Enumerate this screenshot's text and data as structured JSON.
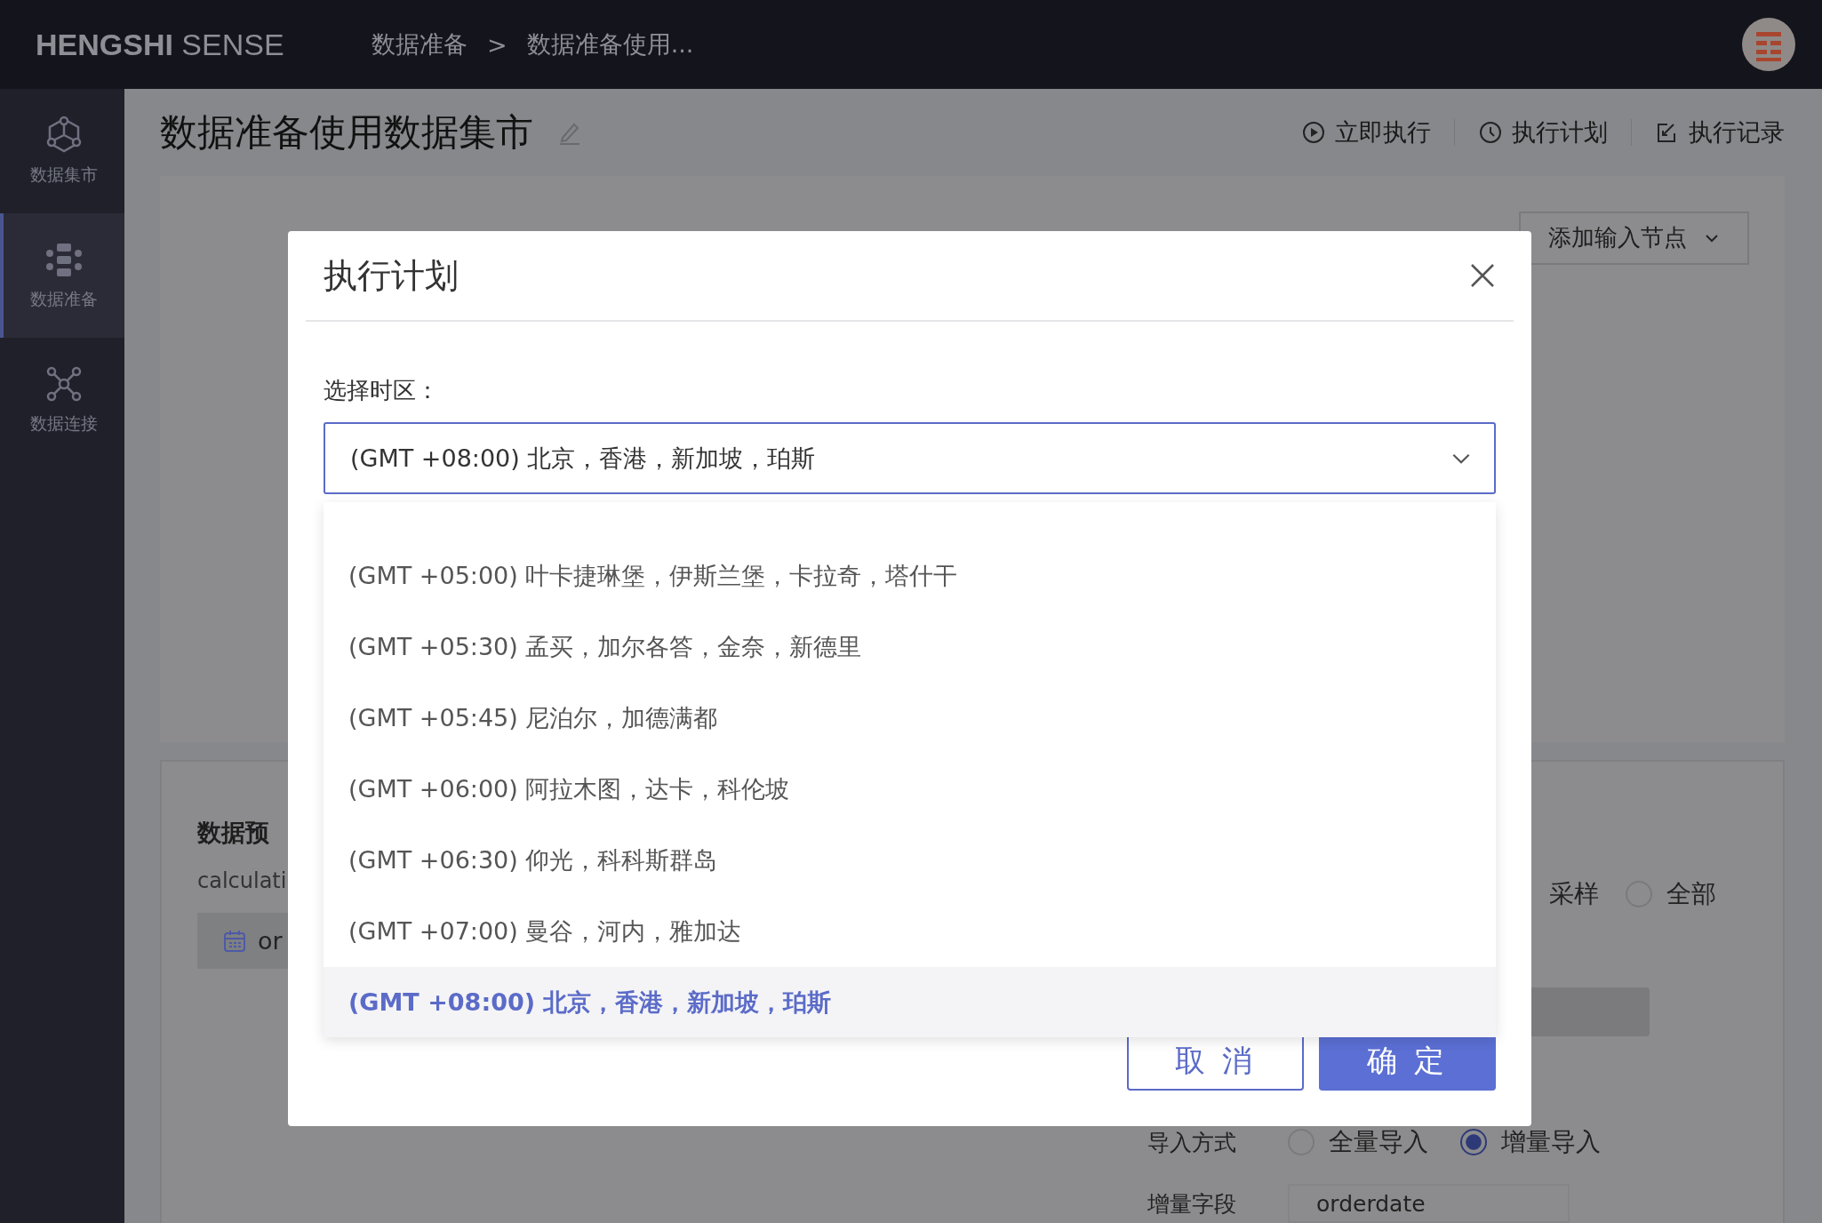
{
  "app": {
    "logo_bold": "HENGSHI",
    "logo_light": "SENSE"
  },
  "breadcrumb": {
    "items": [
      "数据准备",
      "数据准备使用..."
    ],
    "separator": ">"
  },
  "sidebar": {
    "items": [
      {
        "label": "数据集市",
        "kind": "mart",
        "selected": false
      },
      {
        "label": "数据准备",
        "kind": "prep",
        "selected": true
      },
      {
        "label": "数据连接",
        "kind": "connect",
        "selected": false
      }
    ]
  },
  "page": {
    "title": "数据准备使用数据集市",
    "actions": [
      {
        "label": "立即执行",
        "kind": "run"
      },
      {
        "label": "执行计划",
        "kind": "schedule"
      },
      {
        "label": "执行记录",
        "kind": "log"
      }
    ]
  },
  "canvas": {
    "add_node_button": "添加输入节点"
  },
  "preview": {
    "title": "数据预",
    "subtitle": "calculati",
    "chip": "or"
  },
  "sampling": {
    "partial_label": "采样",
    "options": [
      {
        "label": "全部",
        "selected": false
      }
    ]
  },
  "import": {
    "label": "导入方式",
    "options": [
      {
        "label": "全量导入",
        "selected": false
      },
      {
        "label": "增量导入",
        "selected": true
      }
    ]
  },
  "increment": {
    "label": "增量字段",
    "value": "orderdate"
  },
  "dialog": {
    "title": "执行计划",
    "timezone_label": "选择时区：",
    "timezone_value": "(GMT +08:00) 北京，香港，新加坡，珀斯",
    "options": [
      {
        "label": "(GMT +05:00) 叶卡捷琳堡，伊斯兰堡，卡拉奇，塔什干",
        "selected": false
      },
      {
        "label": "(GMT +05:30) 孟买，加尔各答，金奈，新德里",
        "selected": false
      },
      {
        "label": "(GMT +05:45) 尼泊尔，加德满都",
        "selected": false
      },
      {
        "label": "(GMT +06:00) 阿拉木图，达卡，科伦坡",
        "selected": false
      },
      {
        "label": "(GMT +06:30) 仰光，科科斯群岛",
        "selected": false
      },
      {
        "label": "(GMT +07:00) 曼谷，河内，雅加达",
        "selected": false
      },
      {
        "label": "(GMT +08:00) 北京，香港，新加坡，珀斯",
        "selected": true
      }
    ],
    "buttons": [
      {
        "label": "取 消",
        "kind": "secondary"
      },
      {
        "label": "确 定",
        "kind": "primary"
      }
    ]
  }
}
